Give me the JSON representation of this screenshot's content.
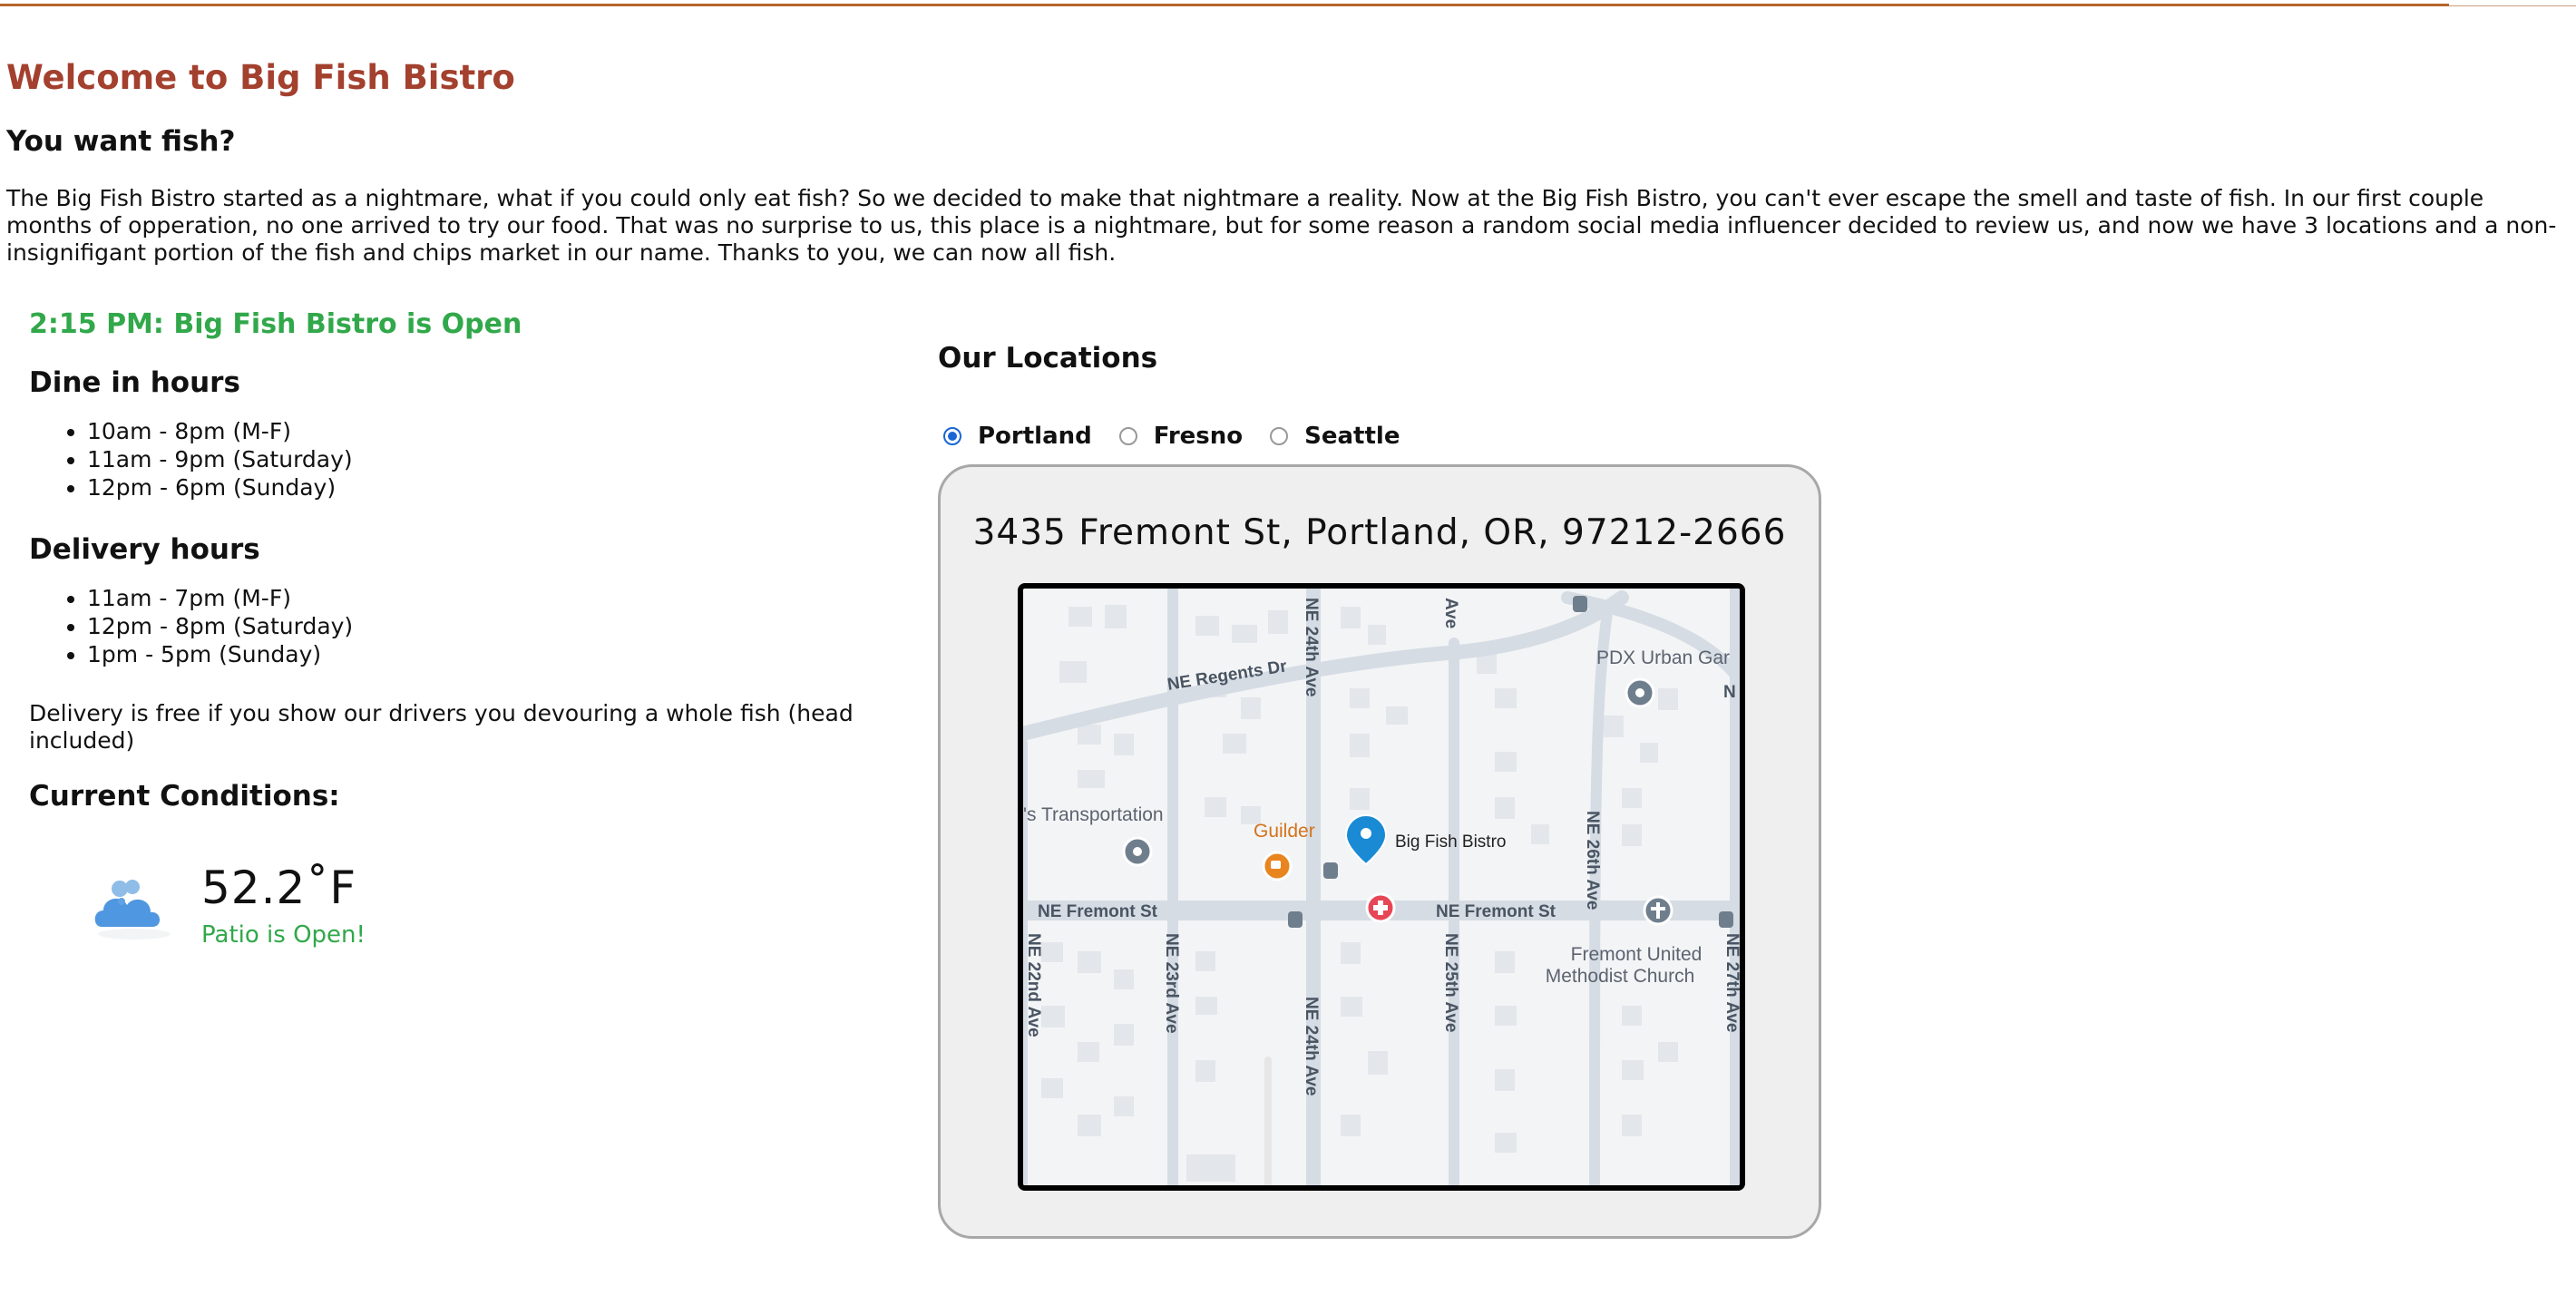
{
  "header": {
    "title": "Welcome to Big Fish Bistro",
    "subtitle": "You want fish?",
    "intro": "The Big Fish Bistro started as a nightmare, what if you could only eat fish? So we decided to make that nightmare a reality. Now at the Big Fish Bistro, you can't ever escape the smell and taste of fish. In our first couple months of opperation, no one arrived to try our food. That was no surprise to us, this place is a nightmare, but for some reason a random social media influencer decided to review us, and now we have 3 locations and a non-insignifigant portion of the fish and chips market in our name. Thanks to you, we can now all fish."
  },
  "status": {
    "text": "2:15 PM: Big Fish Bistro is Open",
    "color": "#31a84a"
  },
  "dine_in": {
    "title": "Dine in hours",
    "items": [
      "10am - 8pm (M-F)",
      "11am - 9pm (Saturday)",
      "12pm - 6pm (Sunday)"
    ]
  },
  "delivery": {
    "title": "Delivery hours",
    "items": [
      "11am - 7pm (M-F)",
      "12pm - 8pm (Saturday)",
      "1pm - 5pm (Sunday)"
    ],
    "note": "Delivery is free if you show our drivers you devouring a whole fish (head included)"
  },
  "conditions": {
    "title": "Current Conditions:",
    "icon": "partly-cloudy-icon",
    "temperature": "52.2˚F",
    "patio": "Patio is Open!"
  },
  "locations": {
    "title": "Our Locations",
    "options": [
      "Portland",
      "Fresno",
      "Seattle"
    ],
    "selected": "Portland",
    "address": "3435 Fremont St, Portland, OR, 97212-2666"
  },
  "map": {
    "streets": {
      "regents": "NE Regents Dr",
      "fremont_left": "NE Fremont St",
      "fremont_right": "NE Fremont St",
      "ave24_top": "NE 24th Ave",
      "ave24_bottom": "NE 24th Ave",
      "ave22": "NE 22nd Ave",
      "ave23": "NE 23rd Ave",
      "ave25_top": "Ave",
      "ave25_bottom": "NE 25th Ave",
      "ave26": "NE 26th Ave",
      "ave27": "NE 27th Ave",
      "right_edge": "N"
    },
    "places": {
      "bistro": "Big Fish Bistro",
      "guilder": "Guilder",
      "transport": "'s Transportation",
      "pdx": "PDX Urban Gar",
      "church_line1": "Fremont United",
      "church_line2": "Methodist Church"
    },
    "colors": {
      "road": "#d5dce4",
      "block": "#e3e6ea",
      "pin_blue": "#1a8ad4",
      "pin_orange": "#e8851f",
      "pin_red": "#e64656",
      "pin_gray": "#6f7e8c"
    }
  }
}
